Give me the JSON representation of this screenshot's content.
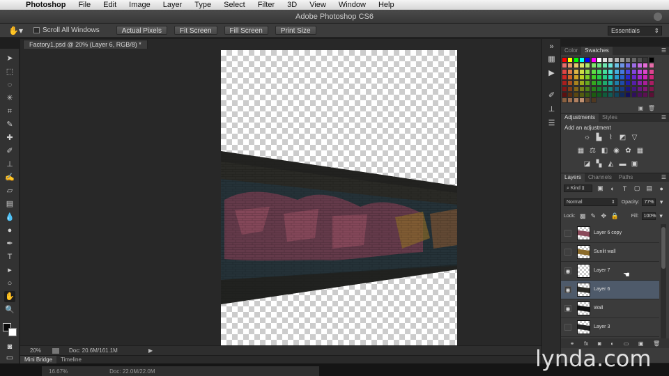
{
  "menubar": {
    "app_name": "Photoshop",
    "items": [
      "File",
      "Edit",
      "Image",
      "Layer",
      "Type",
      "Select",
      "Filter",
      "3D",
      "View",
      "Window",
      "Help"
    ]
  },
  "window": {
    "title": "Adobe Photoshop CS6"
  },
  "options_bar": {
    "scroll_all_windows": "Scroll All Windows",
    "buttons": [
      "Actual Pixels",
      "Fit Screen",
      "Fill Screen",
      "Print Size"
    ],
    "workspace": "Essentials"
  },
  "document": {
    "tab_title": "Factory1.psd @ 20% (Layer 6, RGB/8) *"
  },
  "status_bar": {
    "zoom": "20%",
    "doc_info": "Doc: 20.6M/161.1M"
  },
  "bottom_tabs": [
    "Mini Bridge",
    "Timeline"
  ],
  "background_window": {
    "zoom": "16.67%",
    "doc_info": "Doc: 22.0M/22.0M"
  },
  "panels": {
    "color_tabs": [
      "Color",
      "Swatches"
    ],
    "adjustments_tabs": [
      "Adjustments",
      "Styles"
    ],
    "adjustments_title": "Add an adjustment",
    "layers_tabs": [
      "Layers",
      "Channels",
      "Paths"
    ]
  },
  "layers": {
    "filter_kind": "Kind",
    "blend_mode": "Normal",
    "opacity_label": "Opacity:",
    "opacity": "77%",
    "lock_label": "Lock:",
    "fill_label": "Fill:",
    "fill": "100%",
    "items": [
      {
        "name": "Layer 6 copy",
        "visible": false,
        "selected": false
      },
      {
        "name": "Sunlit wall",
        "visible": false,
        "selected": false
      },
      {
        "name": "Layer 7",
        "visible": true,
        "selected": false
      },
      {
        "name": "Layer 6",
        "visible": true,
        "selected": true
      },
      {
        "name": "Wall",
        "visible": true,
        "selected": false
      },
      {
        "name": "Layer 3",
        "visible": false,
        "selected": false
      }
    ]
  },
  "watermark": "lynda.com",
  "colors": {
    "ui_dark": "#3b3b3b",
    "selection": "#4e5a6a",
    "wall_dark": "#2a2a26",
    "graffiti": "#7a3d50"
  }
}
